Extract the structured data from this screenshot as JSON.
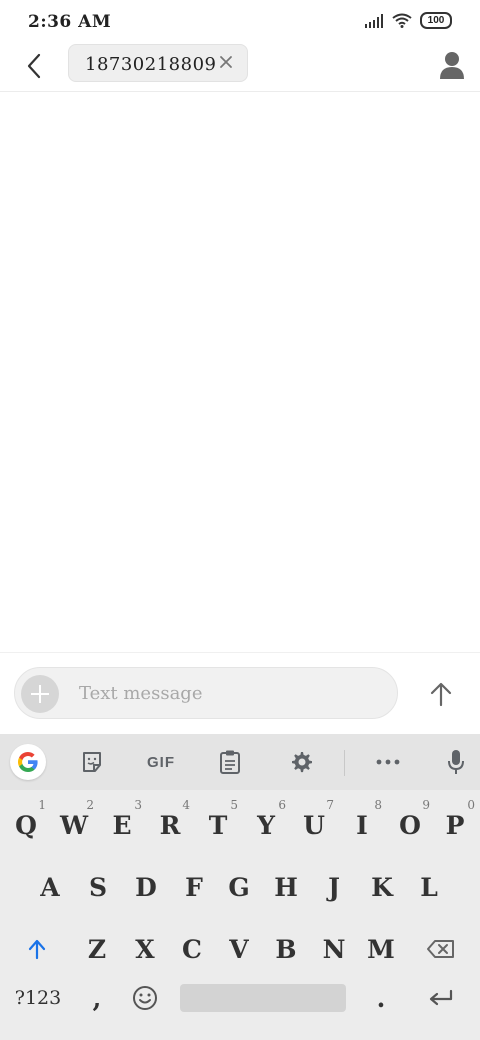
{
  "status_bar": {
    "time": "2:36 AM",
    "battery": "100",
    "icons": [
      "signal-icon",
      "wifi-icon",
      "battery-icon"
    ]
  },
  "header": {
    "back_icon": "back-arrow-icon",
    "recipient": "18730218809",
    "chip_close_icon": "close-icon",
    "contact_icon": "person-icon"
  },
  "compose": {
    "placeholder": "Text message",
    "add_icon": "plus-icon",
    "send_icon": "up-arrow-send-icon"
  },
  "keyboard": {
    "toolbar": {
      "google_icon": "google-g-icon",
      "sticker_icon": "sticker-icon",
      "gif_label": "GIF",
      "clipboard_icon": "clipboard-icon",
      "settings_icon": "gear-icon",
      "more_icon": "more-dots-icon",
      "mic_icon": "microphone-icon"
    },
    "row1": [
      {
        "label": "Q",
        "hint": "1"
      },
      {
        "label": "W",
        "hint": "2"
      },
      {
        "label": "E",
        "hint": "3"
      },
      {
        "label": "R",
        "hint": "4"
      },
      {
        "label": "T",
        "hint": "5"
      },
      {
        "label": "Y",
        "hint": "6"
      },
      {
        "label": "U",
        "hint": "7"
      },
      {
        "label": "I",
        "hint": "8"
      },
      {
        "label": "O",
        "hint": "9"
      },
      {
        "label": "P",
        "hint": "0"
      }
    ],
    "row2": [
      "A",
      "S",
      "D",
      "F",
      "G",
      "H",
      "J",
      "K",
      "L"
    ],
    "row3": [
      "Z",
      "X",
      "C",
      "V",
      "B",
      "N",
      "M"
    ],
    "shift_icon": "shift-arrow-icon",
    "backspace_icon": "backspace-icon",
    "symbols_label": "?123",
    "comma_label": ",",
    "emoji_icon": "emoji-icon",
    "period_label": ".",
    "enter_icon": "enter-icon",
    "accent_color": "#1a73e8"
  }
}
